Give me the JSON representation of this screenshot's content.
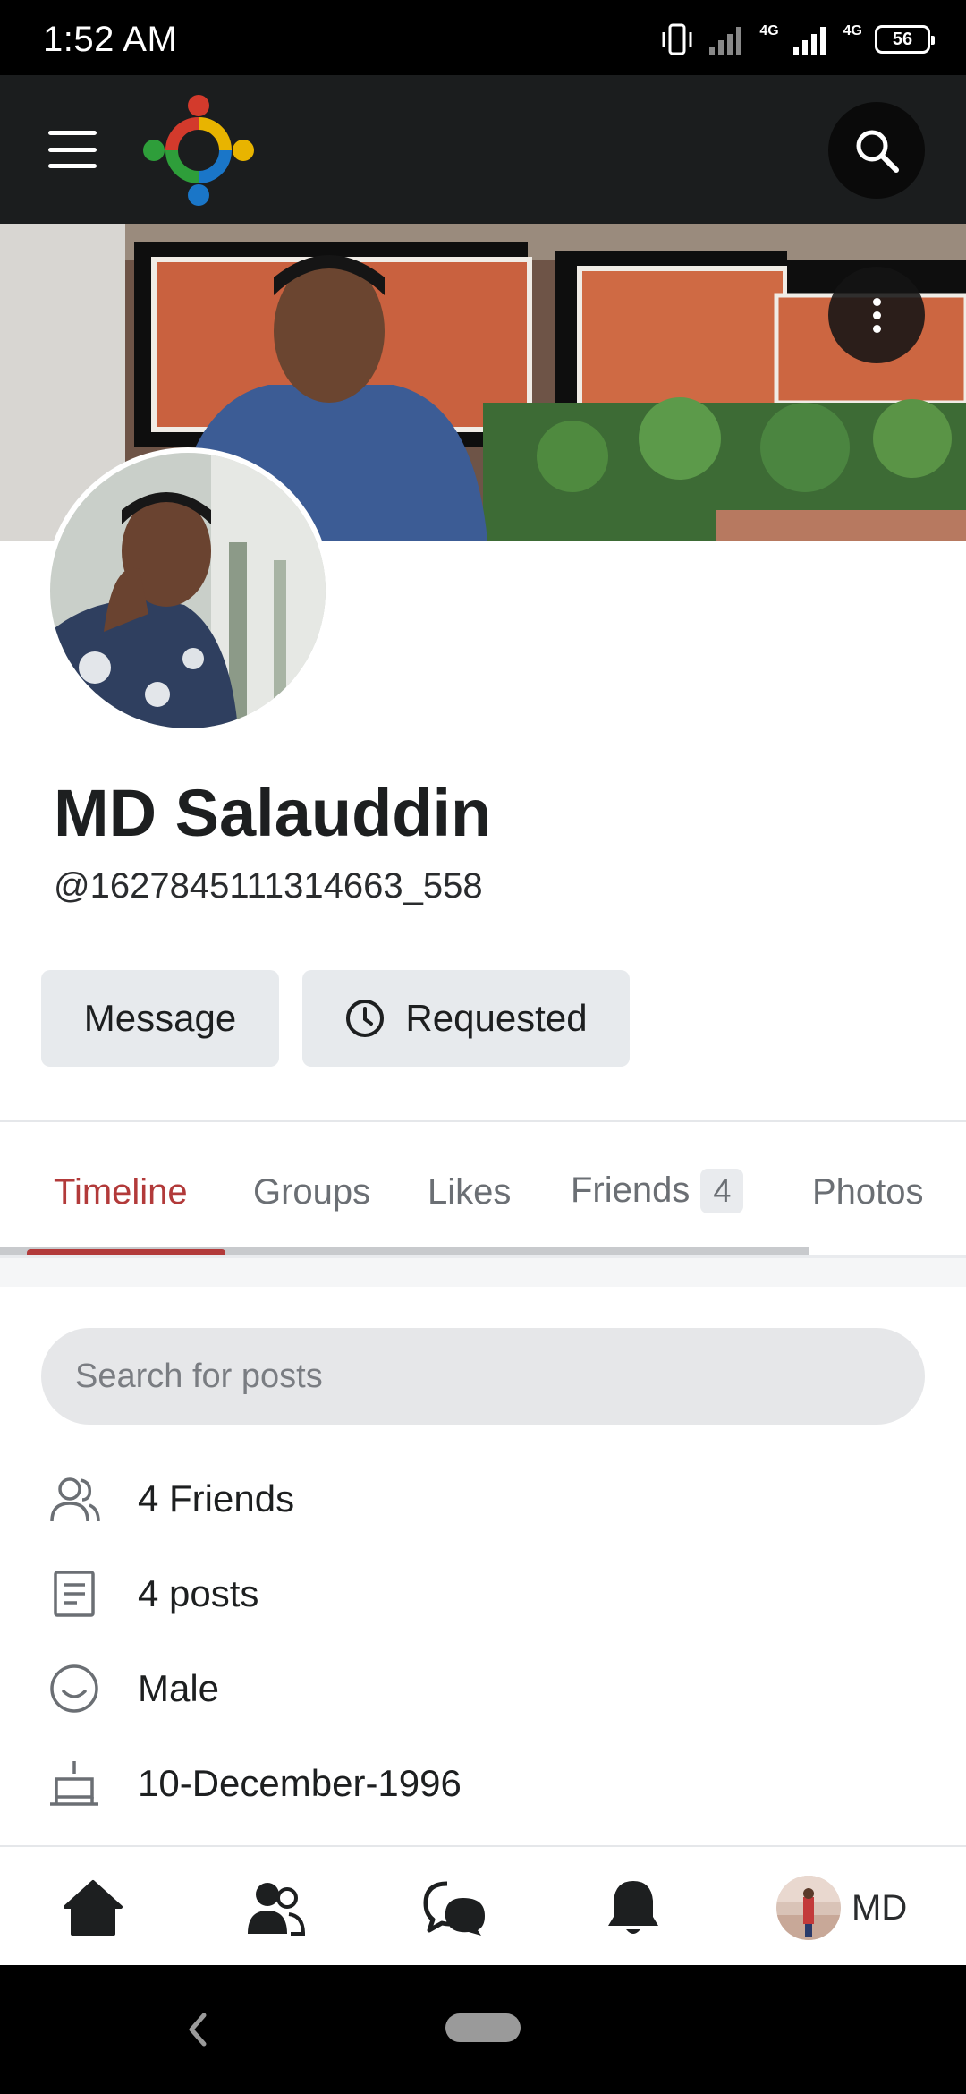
{
  "status_bar": {
    "time": "1:52 AM",
    "network_1": "4G",
    "network_2": "4G",
    "battery": "56"
  },
  "app_bar": {
    "menu_icon": "hamburger-menu-icon",
    "logo": "app-logo",
    "search_icon": "search-icon"
  },
  "cover": {
    "more_icon": "more-vertical-icon"
  },
  "profile": {
    "name": "MD Salauddin",
    "handle": "@1627845111314663_558",
    "message_label": "Message",
    "requested_label": "Requested",
    "requested_icon": "clock-icon"
  },
  "tabs": [
    {
      "label": "Timeline",
      "active": true
    },
    {
      "label": "Groups"
    },
    {
      "label": "Likes"
    },
    {
      "label": "Friends",
      "count": "4"
    },
    {
      "label": "Photos"
    }
  ],
  "search": {
    "placeholder": "Search for posts"
  },
  "info": [
    {
      "icon": "friends-icon",
      "text": "4 Friends"
    },
    {
      "icon": "posts-icon",
      "text": "4 posts"
    },
    {
      "icon": "gender-smile-icon",
      "text": "Male"
    },
    {
      "icon": "birthday-cake-icon",
      "text": "10-December-1996"
    }
  ],
  "bottom_nav": {
    "home_icon": "home-icon",
    "friends_icon": "friends-icon",
    "messages_icon": "chat-bubbles-icon",
    "notifications_icon": "bell-icon",
    "me_label": "MD"
  },
  "colors": {
    "accent": "#b23a3a",
    "app_bar": "#1b1d1e",
    "button_bg": "#e7eaed"
  }
}
